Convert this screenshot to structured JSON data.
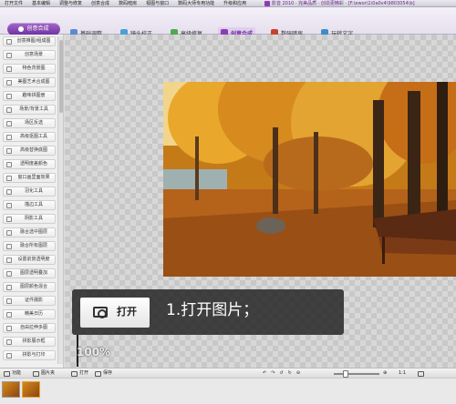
{
  "menu": [
    "打开文件",
    "基本编辑",
    "调整与修复",
    "创意合成",
    "数码暗房",
    "视图与窗口",
    "数码大师专用功能",
    "升级和应用"
  ],
  "app_title": "影音 2010 · 完美品质 · 创造更精彩 · [F:\\ewor\\1\\0a0v4\\9803054\\b]",
  "toolbar": {
    "main_tab": "创意合成",
    "tools": [
      {
        "label": "基础调整",
        "icon": "adjust-icon",
        "color": "#5b8bd0"
      },
      {
        "label": "镜头校正",
        "icon": "lens-icon",
        "color": "#4aa0d8"
      },
      {
        "label": "高级修复",
        "icon": "repair-icon",
        "color": "#4fa852"
      },
      {
        "label": "创意合成",
        "icon": "compose-icon",
        "color": "#8d3bb7",
        "active": true
      },
      {
        "label": "数码暗房",
        "icon": "darkroom-icon",
        "color": "#c5442c"
      },
      {
        "label": "玩转文字",
        "icon": "text-icon",
        "color": "#3a8ec9"
      }
    ]
  },
  "sidebar": {
    "items": [
      "创意推图/组成图",
      "创意场景",
      "特色背景图",
      "美图艺术合成图",
      "趣味拼图册",
      "场景/背景工具",
      "场区反选",
      "高级抠图工具",
      "高级替换底图",
      "透明度差颜色",
      "窗口画里面效果",
      "羽化工具",
      "描边工具",
      "阴影工具",
      "融合选中图层",
      "融合所有图层",
      "设置前景透明度",
      "图层透明叠加",
      "图层颜色混合",
      "证件摄影",
      "精美日历",
      "自由拉伸多图",
      "拼影展示框",
      "拼影与打印"
    ]
  },
  "bottombar": {
    "function": "功能",
    "image_list": "图片夹",
    "open": "打开",
    "save": "保存",
    "zoom_ratio": "1:1"
  },
  "callout": {
    "button_label": "打开",
    "step_text": "1.打开图片；"
  },
  "zoom_display": "100%"
}
